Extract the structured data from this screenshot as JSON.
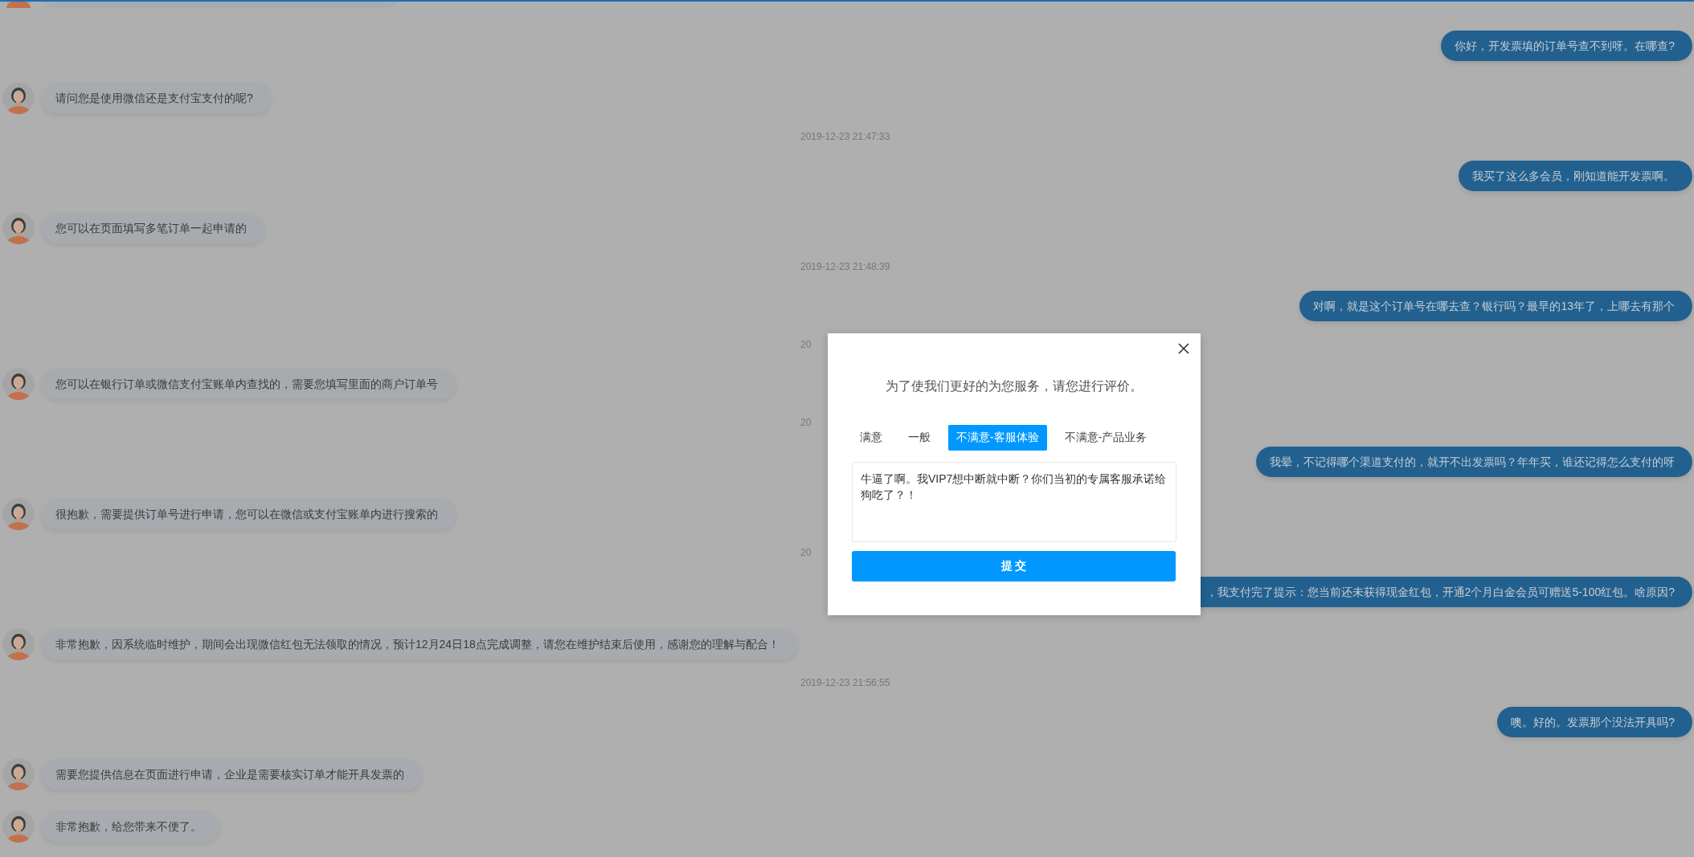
{
  "messages": [
    {
      "kind": "sent",
      "text": "你好，开发票填的订单号查不到呀。在哪查?"
    },
    {
      "kind": "received",
      "text": "请问您是使用微信还是支付宝支付的呢?"
    },
    {
      "kind": "time",
      "text": "2019-12-23 21:47:33"
    },
    {
      "kind": "sent",
      "text": "我买了这么多会员，刚知道能开发票啊。"
    },
    {
      "kind": "received",
      "text": "您可以在页面填写多笔订单一起申请的"
    },
    {
      "kind": "time",
      "text": "2019-12-23 21:48:39"
    },
    {
      "kind": "sent",
      "text": "对啊，就是这个订单号在哪去查？银行吗？最早的13年了，上哪去有那个"
    },
    {
      "kind": "time",
      "text": "20"
    },
    {
      "kind": "received",
      "text": "您可以在银行订单或微信支付宝账单内查找的，需要您填写里面的商户订单号"
    },
    {
      "kind": "time",
      "text": "20"
    },
    {
      "kind": "sent",
      "text": "我晕，不记得哪个渠道支付的，就开不出发票吗？年年买，谁还记得怎么支付的呀"
    },
    {
      "kind": "received",
      "text": "很抱歉，需要提供订单号进行申请，您可以在微信或支付宝账单内进行搜索的"
    },
    {
      "kind": "time",
      "text": "20"
    },
    {
      "kind": "sent",
      "text": "，我支付完了提示：您当前还未获得现金红包，开通2个月白金会员可赠送5-100红包。啥原因?",
      "covered_by_dialog": true
    },
    {
      "kind": "received",
      "text": "非常抱歉，因系统临时维护，期间会出现微信红包无法领取的情况，预计12月24日18点完成调整，请您在维护结束后使用，感谢您的理解与配合！"
    },
    {
      "kind": "time",
      "text": "2019-12-23 21:56:55"
    },
    {
      "kind": "sent",
      "text": "噢。好的。发票那个没法开具吗?"
    },
    {
      "kind": "received",
      "text": "需要您提供信息在页面进行申请，企业是需要核实订单才能开具发票的"
    },
    {
      "kind": "received",
      "text": "非常抱歉，给您带来不便了。"
    }
  ],
  "dialog": {
    "prompt": "为了使我们更好的为您服务，请您进行评价。",
    "options": [
      {
        "label": "满意",
        "selected": false
      },
      {
        "label": "一般",
        "selected": false
      },
      {
        "label": "不满意-客服体验",
        "selected": true
      },
      {
        "label": "不满意-产品业务",
        "selected": false
      }
    ],
    "comment": "牛逼了啊。我VIP7想中断就中断？你们当初的专属客服承诺给狗吃了？！",
    "submit": "提 交"
  }
}
